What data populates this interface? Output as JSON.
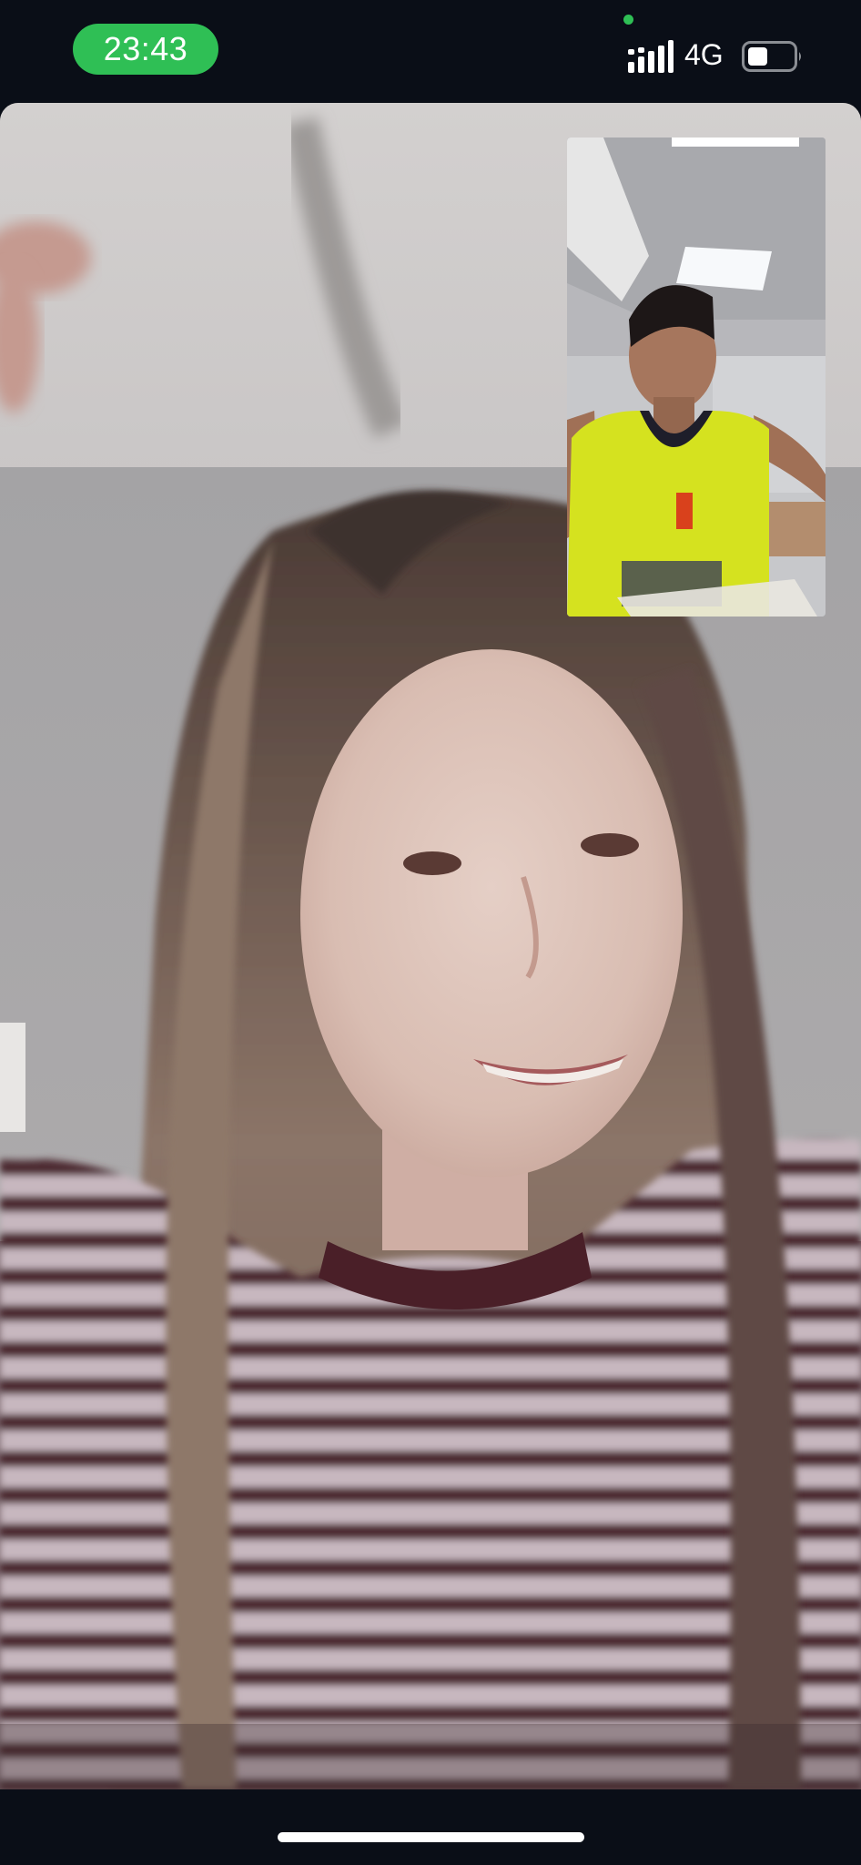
{
  "status_bar": {
    "time": "23:43",
    "network": "4G",
    "signal_bars": 4,
    "battery_level": 0.45,
    "colors": {
      "time_pill": "#2fbf55",
      "background": "#0a0e17"
    }
  },
  "call": {
    "remote_video": {
      "content": "remote-participant-video"
    },
    "self_preview": {
      "content": "local-camera-preview"
    }
  },
  "icons": {
    "signal": "signal-strength-icon",
    "battery": "battery-icon",
    "privacy_indicator": "camera-in-use-dot"
  }
}
